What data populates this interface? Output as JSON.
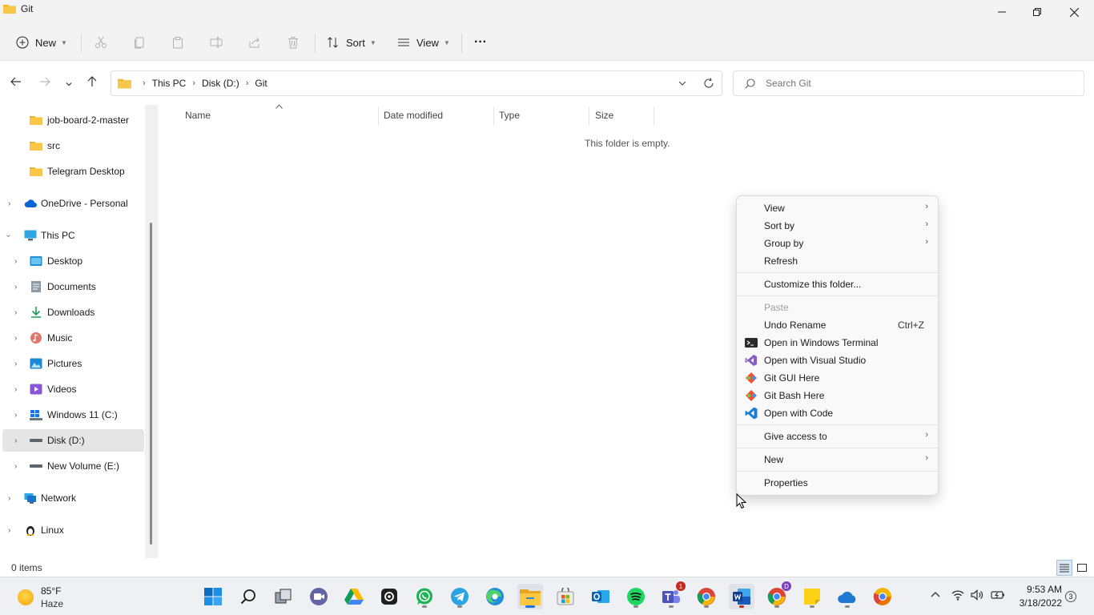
{
  "window": {
    "title": "Git"
  },
  "toolbar": {
    "new_label": "New",
    "sort_label": "Sort",
    "view_label": "View",
    "more_label": "···"
  },
  "address": {
    "crumbs": [
      "This PC",
      "Disk (D:)",
      "Git"
    ]
  },
  "search": {
    "placeholder": "Search Git"
  },
  "sidebar": {
    "items": [
      {
        "label": "job-board-2-master"
      },
      {
        "label": "src"
      },
      {
        "label": "Telegram Desktop"
      },
      {
        "label": "OneDrive - Personal"
      },
      {
        "label": "This PC"
      },
      {
        "label": "Desktop"
      },
      {
        "label": "Documents"
      },
      {
        "label": "Downloads"
      },
      {
        "label": "Music"
      },
      {
        "label": "Pictures"
      },
      {
        "label": "Videos"
      },
      {
        "label": "Windows 11 (C:)"
      },
      {
        "label": "Disk (D:)"
      },
      {
        "label": "New Volume (E:)"
      },
      {
        "label": "Network"
      },
      {
        "label": "Linux"
      }
    ]
  },
  "columns": [
    "Name",
    "Date modified",
    "Type",
    "Size"
  ],
  "content": {
    "empty_message": "This folder is empty."
  },
  "status": {
    "item_count": "0 items"
  },
  "context_menu": {
    "items": [
      {
        "label": "View"
      },
      {
        "label": "Sort by"
      },
      {
        "label": "Group by"
      },
      {
        "label": "Refresh"
      },
      {
        "label": "Customize this folder..."
      },
      {
        "label": "Paste"
      },
      {
        "label": "Undo Rename",
        "shortcut": "Ctrl+Z"
      },
      {
        "label": "Open in Windows Terminal"
      },
      {
        "label": "Open with Visual Studio"
      },
      {
        "label": "Git GUI Here"
      },
      {
        "label": "Git Bash Here"
      },
      {
        "label": "Open with Code"
      },
      {
        "label": "Give access to"
      },
      {
        "label": "New"
      },
      {
        "label": "Properties"
      }
    ]
  },
  "taskbar": {
    "weather": {
      "temp": "85°F",
      "desc": "Haze"
    },
    "time": "9:53 AM",
    "date": "3/18/2022",
    "notifications": "3",
    "teams_badge": "1",
    "chrome_profile_badge": "D"
  },
  "colors": {
    "accent": "#0067c0",
    "folder": "#f8c649",
    "selected": "#e5e5e5"
  }
}
